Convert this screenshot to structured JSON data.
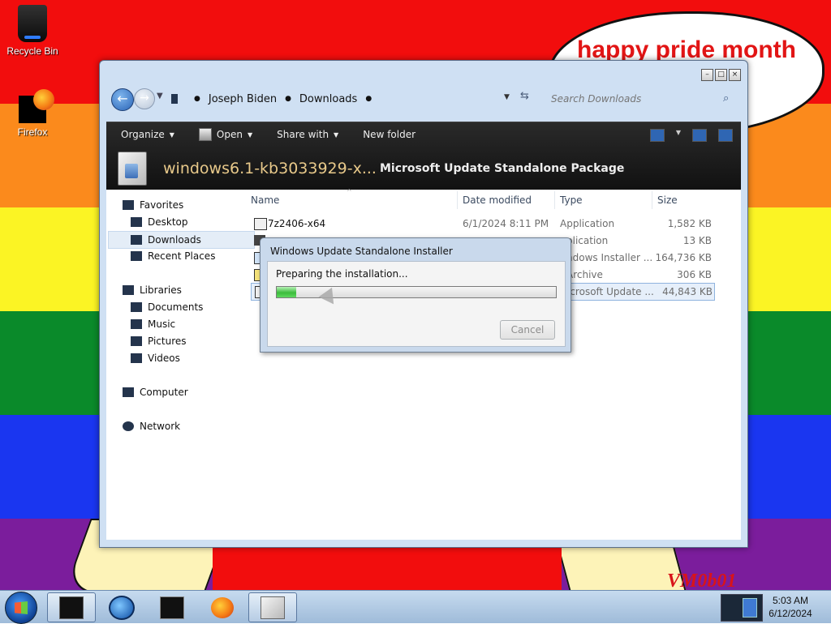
{
  "desktop": {
    "speech_bubble_text": "happy pride month",
    "signature": "VM0b01",
    "icons": [
      {
        "label": "Recycle Bin",
        "icon": "recycle-bin-icon"
      },
      {
        "label": "Firefox",
        "icon": "firefox-icon"
      }
    ],
    "wallpaper_colors": [
      "#f20d0d",
      "#fb8a1c",
      "#fbf424",
      "#0a8a2a",
      "#1a36f0",
      "#7b1d9c"
    ]
  },
  "explorer": {
    "title_buttons": [
      "minimize",
      "maximize",
      "close"
    ],
    "breadcrumb": [
      "Joseph Biden",
      "Downloads"
    ],
    "search_placeholder": "Search Downloads",
    "toolbar": {
      "organize": "Organize",
      "open": "Open",
      "share_with": "Share with",
      "new_folder": "New folder"
    },
    "details": {
      "name": "windows6.1-kb3033929-x...",
      "type": "Microsoft Update Standalone Package"
    },
    "nav": {
      "favorites": "Favorites",
      "desktop": "Desktop",
      "downloads": "Downloads",
      "recent_places": "Recent Places",
      "libraries": "Libraries",
      "documents": "Documents",
      "music": "Music",
      "pictures": "Pictures",
      "videos": "Videos",
      "computer": "Computer",
      "network": "Network"
    },
    "columns": {
      "name": "Name",
      "date_modified": "Date modified",
      "type": "Type",
      "size": "Size"
    },
    "files": [
      {
        "name": "7z2406-x64",
        "date": "6/1/2024 8:11 PM",
        "type": "Application",
        "size": "1,582 KB"
      },
      {
        "name": "",
        "date": "",
        "type": "plication",
        "size": "13 KB"
      },
      {
        "name": "",
        "date": "",
        "type": "ndows Installer ...",
        "size": "164,736 KB"
      },
      {
        "name": "",
        "date": "",
        "type": "Archive",
        "size": "306 KB"
      },
      {
        "name": "",
        "date": "",
        "type": "icrosoft Update ...",
        "size": "44,843 KB"
      }
    ]
  },
  "installer": {
    "title": "Windows Update Standalone Installer",
    "message": "Preparing the installation...",
    "progress_fraction": 0.07,
    "cancel_label": "Cancel"
  },
  "taskbar": {
    "time": "5:03 AM",
    "date": "6/12/2024",
    "pinned": [
      "terminal-icon",
      "media-player-icon",
      "command-prompt-icon",
      "firefox-icon",
      "update-package-icon"
    ]
  }
}
